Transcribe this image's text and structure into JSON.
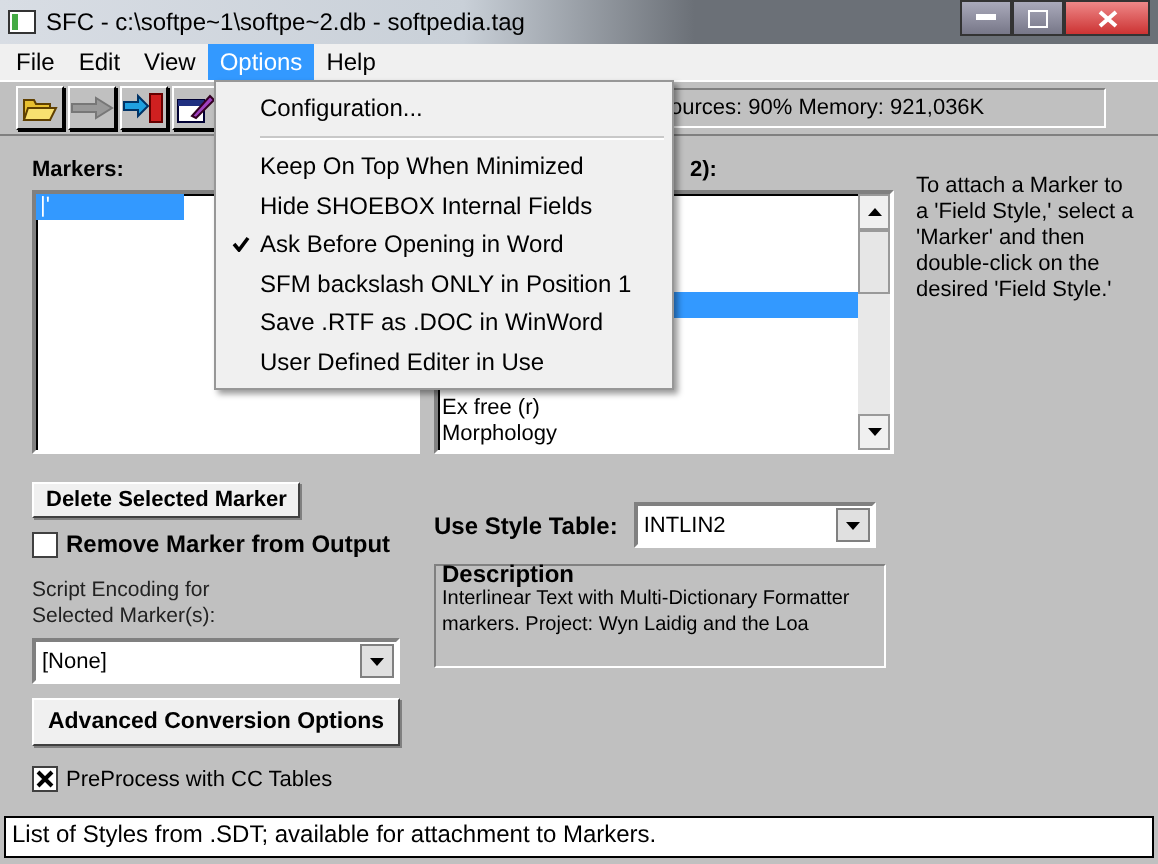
{
  "window": {
    "title": "SFC - c:\\softpe~1\\softpe~2.db - softpedia.tag"
  },
  "menu": [
    {
      "label": "File",
      "selected": false
    },
    {
      "label": "Edit",
      "selected": false
    },
    {
      "label": "View",
      "selected": false
    },
    {
      "label": "Options",
      "selected": true
    },
    {
      "label": "Help",
      "selected": false
    }
  ],
  "options_menu": [
    {
      "kind": "item",
      "label": "Configuration...",
      "checked": false
    },
    {
      "kind": "separator"
    },
    {
      "kind": "item",
      "label": "Keep On Top When Minimized",
      "checked": false
    },
    {
      "kind": "item",
      "label": "Hide SHOEBOX Internal Fields",
      "checked": false
    },
    {
      "kind": "item",
      "label": "Ask Before Opening in Word",
      "checked": true
    },
    {
      "kind": "item",
      "label": "SFM backslash ONLY in Position 1",
      "checked": false
    },
    {
      "kind": "item",
      "label": "Save .RTF as .DOC in WinWord",
      "checked": false
    },
    {
      "kind": "item",
      "label": "User Defined Editer in Use",
      "checked": false
    }
  ],
  "toolbar": {
    "status": "ources: 90%  Memory: 921,036K"
  },
  "markers": {
    "label": "Markers:",
    "items": [
      {
        "text": "|'",
        "selected": true
      }
    ]
  },
  "field_styles": {
    "label": "2):",
    "items": [
      {
        "selected": false
      },
      {
        "selected": false
      },
      {
        "selected": false
      },
      {
        "selected": true
      },
      {
        "selected": false
      },
      {
        "selected": false
      },
      {
        "selected": false
      },
      {
        "text": "Ex free (r)",
        "selected": false
      },
      {
        "text": "Morphology",
        "selected": false
      }
    ]
  },
  "help_text": "To attach a Marker to a 'Field Style,' select a 'Marker' and then double-click on the desired 'Field Style.'",
  "delete_button": "Delete Selected Marker",
  "remove_marker": {
    "label": "Remove Marker from Output",
    "checked": false
  },
  "script_encoding": {
    "label": "Script Encoding for Selected Marker(s):",
    "value": "[None]"
  },
  "advanced_button": "Advanced Conversion Options",
  "preprocess": {
    "label": "PreProcess with CC Tables",
    "checked": true
  },
  "style_table": {
    "label": "Use Style Table:",
    "value": "INTLIN2"
  },
  "description": {
    "title": "Description",
    "text": "Interlinear Text with Multi-Dictionary Formatter markers. Project: Wyn Laidig and the Loa"
  },
  "status_bar": "List of Styles from .SDT; available for attachment to Markers."
}
